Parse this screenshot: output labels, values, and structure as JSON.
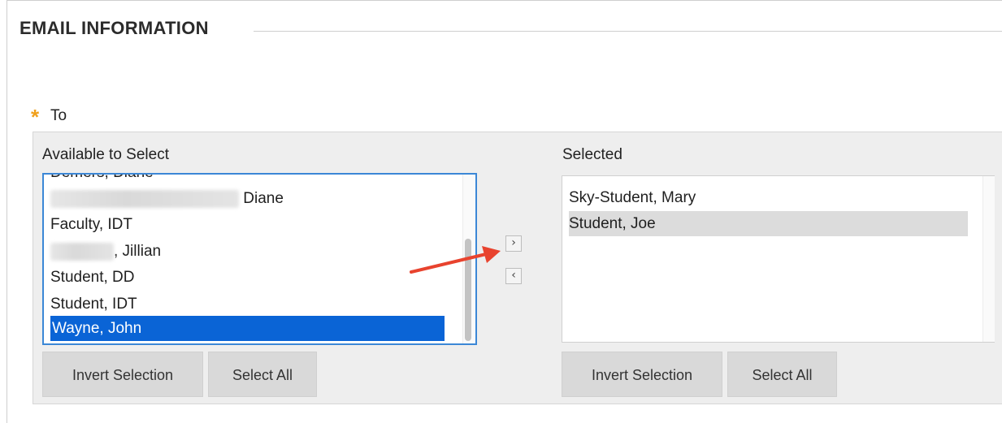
{
  "section": {
    "title": "EMAIL INFORMATION"
  },
  "to_field": {
    "required_marker": "*",
    "label": "To"
  },
  "available": {
    "title": "Available to Select",
    "items": [
      {
        "text": "Demers, Diane",
        "partially_hidden": true
      },
      {
        "text": "Diane",
        "blurred_prefix": true
      },
      {
        "text": "Faculty, IDT"
      },
      {
        "text": ", Jillian",
        "blurred_prefix": true
      },
      {
        "text": "Student, DD"
      },
      {
        "text": "Student, IDT"
      },
      {
        "text": "Wayne, John",
        "selected": true
      }
    ],
    "invert_label": "Invert Selection",
    "select_all_label": "Select All"
  },
  "selected": {
    "title": "Selected",
    "items": [
      {
        "text": "Sky-Student, Mary"
      },
      {
        "text": "Student, Joe",
        "highlighted": true
      }
    ],
    "invert_label": "Invert Selection",
    "select_all_label": "Select All"
  },
  "move_buttons": {
    "add_glyph": "›",
    "remove_glyph": "‹"
  },
  "colors": {
    "selected_bg": "#0a64d6",
    "focus_border": "#3b87d6",
    "required": "#f0a01b",
    "annotation_arrow": "#e8432e"
  }
}
